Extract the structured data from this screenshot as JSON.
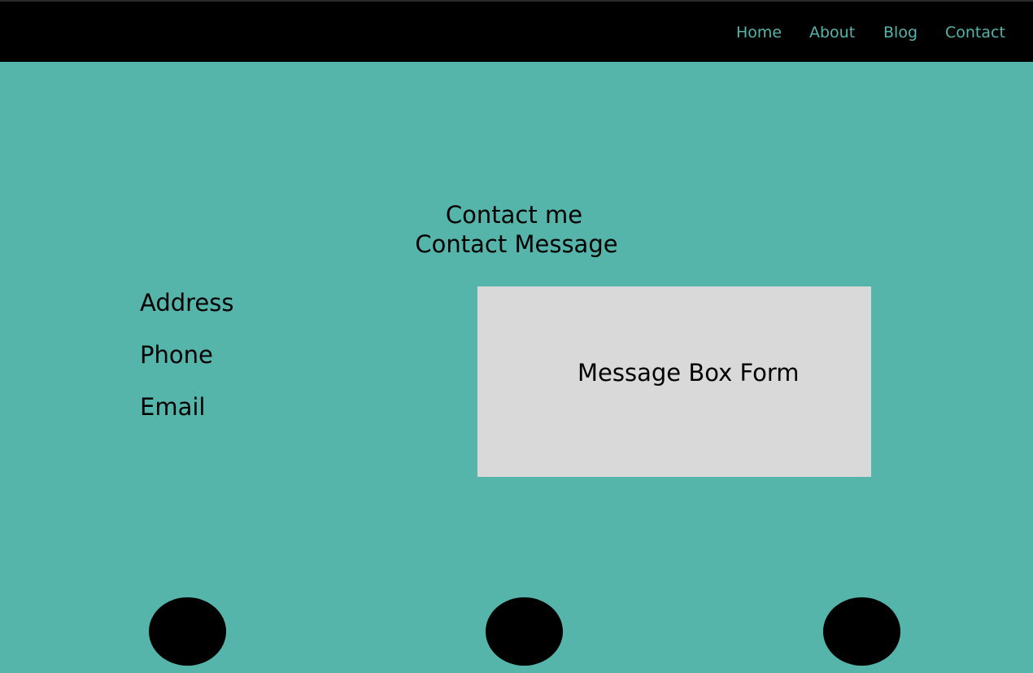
{
  "nav": {
    "items": [
      "Home",
      "About",
      "Blog",
      "Contact"
    ]
  },
  "hero": {
    "title": "Contact me",
    "subtitle": "Contact Message"
  },
  "contact_info": {
    "address_label": "Address",
    "phone_label": "Phone",
    "email_label": "Email"
  },
  "message_box": {
    "label": "Message Box Form"
  },
  "social_icons": [
    "social-icon",
    "social-icon",
    "social-icon"
  ],
  "colors": {
    "background": "#55b5aa",
    "nav_bar": "#000000",
    "nav_link": "#55b5aa",
    "message_box": "#d9d9d9",
    "social_circle": "#000000"
  }
}
